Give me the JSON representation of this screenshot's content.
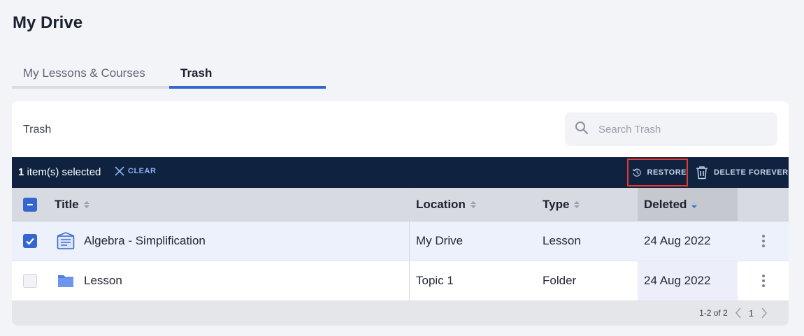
{
  "page": {
    "title": "My Drive"
  },
  "tabs": [
    {
      "label": "My Lessons & Courses",
      "active": false
    },
    {
      "label": "Trash",
      "active": true
    }
  ],
  "card": {
    "title": "Trash"
  },
  "search": {
    "placeholder": "Search Trash",
    "icon": "search-icon"
  },
  "action_bar": {
    "selected_count": "1",
    "selected_suffix": " item(s) selected",
    "clear_label": "CLEAR",
    "restore_label": "RESTORE",
    "delete_label": "DELETE FOREVER",
    "restore_highlighted": true
  },
  "table": {
    "columns": [
      "Title",
      "Location",
      "Type",
      "Deleted"
    ],
    "sort": {
      "column": "Deleted",
      "direction": "descending"
    },
    "rows": [
      {
        "title": "Algebra - Simplification",
        "location": "My Drive",
        "type": "Lesson",
        "deleted": "24 Aug 2022",
        "selected": true,
        "icon": "lesson-icon"
      },
      {
        "title": "Lesson",
        "location": "Topic 1",
        "type": "Folder",
        "deleted": "24 Aug 2022",
        "selected": false,
        "icon": "folder-icon"
      }
    ]
  },
  "pagination": {
    "range": "1-2 of 2",
    "page": "1"
  },
  "colors": {
    "accent": "#3565cf",
    "action_bar": "#0f2340",
    "highlight_border": "#e23a2f"
  }
}
